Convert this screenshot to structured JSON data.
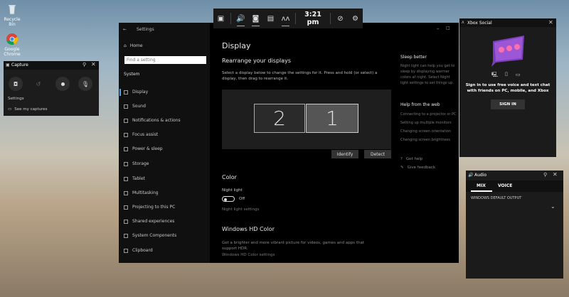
{
  "desktop": {
    "icons": [
      {
        "label": "Recycle Bin"
      },
      {
        "label": "Google Chrome"
      }
    ]
  },
  "gamebar": {
    "clock": "3:21 pm",
    "buttons": [
      "widget-menu",
      "audio",
      "capture",
      "performance",
      "xbox-social",
      "looking-for-group",
      "settings"
    ]
  },
  "settings": {
    "window_title": "Settings",
    "home": "Home",
    "search_placeholder": "Find a setting",
    "section": "System",
    "nav": [
      "Display",
      "Sound",
      "Notifications & actions",
      "Focus assist",
      "Power & sleep",
      "Storage",
      "Tablet",
      "Multitasking",
      "Projecting to this PC",
      "Shared experiences",
      "System Components",
      "Clipboard"
    ],
    "page_title": "Display",
    "rearrange_title": "Rearrange your displays",
    "rearrange_desc": "Select a display below to change the settings for it. Press and hold (or select) a display, then drag to rearrange it.",
    "monitor_2": "2",
    "monitor_1": "1",
    "identify": "Identify",
    "detect": "Detect",
    "color_title": "Color",
    "night_light_label": "Night light",
    "night_light_state": "Off",
    "night_light_settings": "Night light settings",
    "hd_title": "Windows HD Color",
    "hd_desc": "Get a brighter and more vibrant picture for videos, games and apps that support HDR.",
    "hd_link": "Windows HD Color settings",
    "sleep_title": "Sleep better",
    "sleep_desc": "Night light can help you get to sleep by displaying warmer colors at night. Select Night light settings to set things up.",
    "help_title": "Help from the web",
    "help_links": [
      "Connecting to a projector or PC",
      "Setting up multiple monitors",
      "Changing screen orientation",
      "Changing screen brightness"
    ],
    "get_help": "Get help",
    "give_feedback": "Give feedback"
  },
  "capture": {
    "title": "Capture",
    "settings_label": "Settings",
    "see_captures": "See my captures"
  },
  "social": {
    "title": "Xbox Social",
    "message": "Sign in to use free voice and text chat with friends on PC, mobile, and Xbox",
    "button": "SIGN IN"
  },
  "audio": {
    "title": "Audio",
    "tabs": [
      "MIX",
      "VOICE"
    ],
    "output_label": "WINDOWS DEFAULT OUTPUT"
  }
}
